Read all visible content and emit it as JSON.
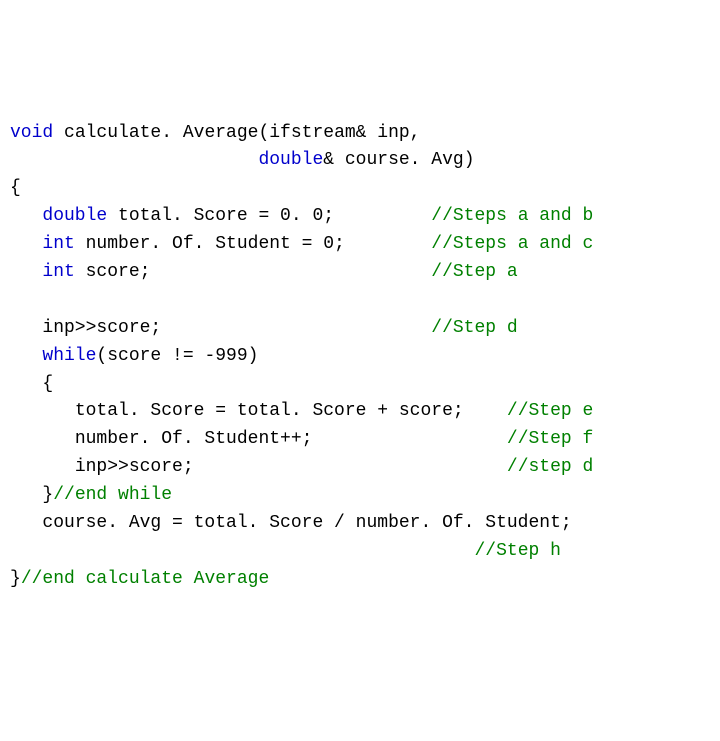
{
  "lines": [
    {
      "indent": 0,
      "parts": [
        {
          "t": "void",
          "c": "kw"
        },
        {
          "t": " calculate. Average(ifstream& inp,"
        }
      ]
    },
    {
      "indent": 0,
      "parts": [
        {
          "t": "                       "
        },
        {
          "t": "double",
          "c": "kw"
        },
        {
          "t": "& course. Avg)"
        }
      ]
    },
    {
      "indent": 0,
      "parts": [
        {
          "t": "{"
        }
      ]
    },
    {
      "indent": 1,
      "parts": [
        {
          "t": "double",
          "c": "kw"
        },
        {
          "t": " total. Score = 0. 0;         "
        },
        {
          "t": "//Steps a and b",
          "c": "cm"
        }
      ]
    },
    {
      "indent": 1,
      "parts": [
        {
          "t": "int",
          "c": "kw"
        },
        {
          "t": " number. Of. Student = 0;        "
        },
        {
          "t": "//Steps a and c",
          "c": "cm"
        }
      ]
    },
    {
      "indent": 1,
      "parts": [
        {
          "t": "int",
          "c": "kw"
        },
        {
          "t": " score;                          "
        },
        {
          "t": "//Step a",
          "c": "cm"
        }
      ]
    },
    {
      "indent": 0,
      "parts": [
        {
          "t": " "
        }
      ]
    },
    {
      "indent": 1,
      "parts": [
        {
          "t": "inp>>score;                         "
        },
        {
          "t": "//Step d",
          "c": "cm"
        }
      ]
    },
    {
      "indent": 1,
      "parts": [
        {
          "t": "while",
          "c": "kw"
        },
        {
          "t": "(score != -999)"
        }
      ]
    },
    {
      "indent": 1,
      "parts": [
        {
          "t": "{"
        }
      ]
    },
    {
      "indent": 2,
      "parts": [
        {
          "t": "total. Score = total. Score + score;    "
        },
        {
          "t": "//Step e",
          "c": "cm"
        }
      ]
    },
    {
      "indent": 2,
      "parts": [
        {
          "t": "number. Of. Student++;                  "
        },
        {
          "t": "//Step f",
          "c": "cm"
        }
      ]
    },
    {
      "indent": 2,
      "parts": [
        {
          "t": "inp>>score;                             "
        },
        {
          "t": "//step d",
          "c": "cm"
        }
      ]
    },
    {
      "indent": 1,
      "parts": [
        {
          "t": "}"
        },
        {
          "t": "//end while",
          "c": "cm"
        }
      ]
    },
    {
      "indent": 1,
      "parts": [
        {
          "t": "course. Avg = total. Score / number. Of. Student;"
        }
      ]
    },
    {
      "indent": 1,
      "parts": [
        {
          "t": "                                        "
        },
        {
          "t": "//Step h",
          "c": "cm"
        }
      ]
    },
    {
      "indent": 0,
      "parts": [
        {
          "t": "}"
        },
        {
          "t": "//end calculate Average",
          "c": "cm"
        }
      ]
    }
  ],
  "indent_unit": "   "
}
